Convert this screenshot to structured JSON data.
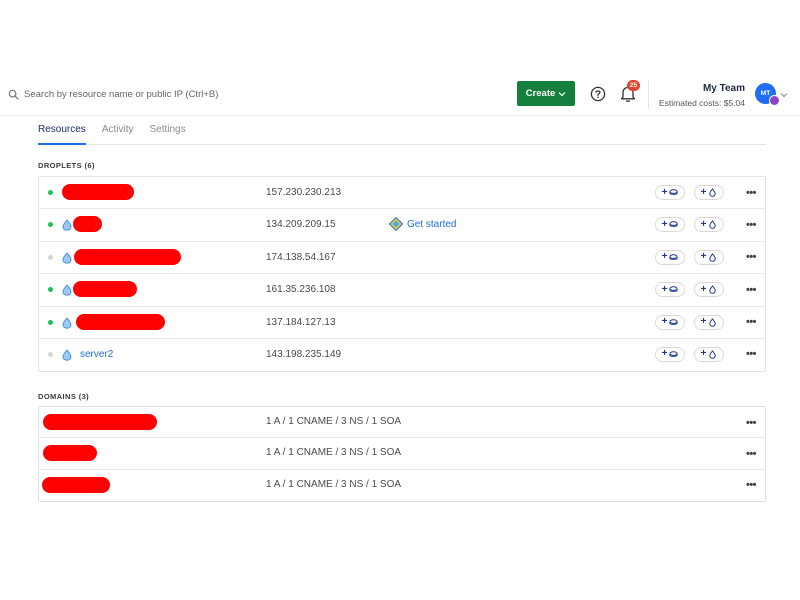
{
  "search": {
    "placeholder": "Search by resource name or public IP (Ctrl+B)"
  },
  "header": {
    "create_label": "Create",
    "notification_count": "25",
    "team_name": "My Team",
    "estimated_costs": "Estimated costs: $5.04",
    "avatar_initials": "MT"
  },
  "tabs": [
    {
      "label": "Resources",
      "active": true
    },
    {
      "label": "Activity",
      "active": false
    },
    {
      "label": "Settings",
      "active": false
    }
  ],
  "droplets": {
    "title": "DROPLETS (6)",
    "rows": [
      {
        "name": "",
        "ip": "157.230.230.213",
        "status": "on",
        "status_color": "#1fbf5a",
        "redacted": true
      },
      {
        "name": "",
        "ip": "134.209.209.15",
        "status": "on",
        "status_color": "#1fbf5a",
        "redacted": true,
        "get_started": "Get started"
      },
      {
        "name": "",
        "ip": "174.138.54.167",
        "status": "off",
        "status_color": "#d6d6d6",
        "redacted": true
      },
      {
        "name": "",
        "ip": "161.35.236.108",
        "status": "on",
        "status_color": "#1fbf5a",
        "redacted": true
      },
      {
        "name": "",
        "ip": "137.184.127.13",
        "status": "on",
        "status_color": "#1fbf5a",
        "redacted": true
      },
      {
        "name": "server2",
        "ip": "143.198.235.149",
        "status": "off",
        "status_color": "#d6d6d6",
        "redacted": false
      }
    ]
  },
  "domains": {
    "title": "DOMAINS (3)",
    "rows": [
      {
        "records": "1 A / 1 CNAME / 3 NS / 1 SOA",
        "redacted": true
      },
      {
        "records": "1 A / 1 CNAME / 3 NS / 1 SOA",
        "redacted": true
      },
      {
        "records": "1 A / 1 CNAME / 3 NS / 1 SOA",
        "redacted": true
      }
    ]
  },
  "colors": {
    "accent": "#1f6fe0",
    "create_button": "#15803d",
    "redaction": "#ff0000",
    "badge": "#e2442f"
  },
  "icons": {
    "search": "search-icon",
    "help": "help-circle-icon",
    "bell": "bell-icon",
    "droplet": "droplet-icon",
    "volume": "add-volume-icon",
    "backup": "add-backup-icon",
    "more": "more-horizontal-icon",
    "get_started": "get-started-diamond-icon"
  }
}
